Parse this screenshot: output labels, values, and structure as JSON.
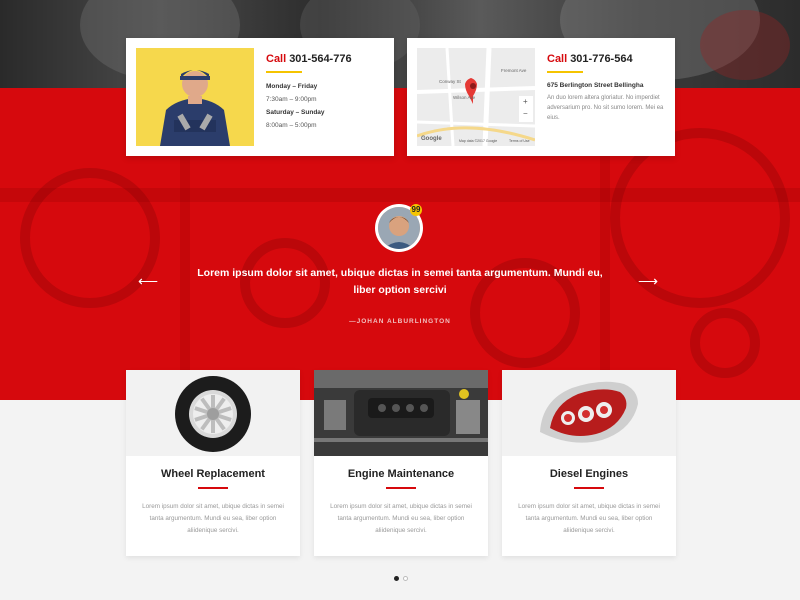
{
  "contacts": [
    {
      "call_word": "Call",
      "phone": "301-564-776",
      "hours": [
        {
          "day": "Monday – Friday",
          "time": "7:30am – 9:00pm"
        },
        {
          "day": "Saturday – Sunday",
          "time": "8:00am – 5:00pm"
        }
      ]
    },
    {
      "call_word": "Call",
      "phone": "301-776-564",
      "address": "675 Berlington Street Bellingha",
      "description": "An duo lorem altera gloriatur. No imperdiet adversarium pro. No sit sumo lorem. Mei ea eius."
    }
  ],
  "map": {
    "labels": [
      "Conway St",
      "Wilson Ave",
      "Fremont Ave",
      "Google",
      "Map data ©2017 Google",
      "Terms of Use"
    ],
    "zoom_in": "+",
    "zoom_out": "−"
  },
  "testimonial": {
    "badge": "99",
    "quote": "Lorem ipsum dolor sit amet, ubique dictas in semei tanta argumentum. Mundi eu, liber option sercivi",
    "author": "—JOHAN ALBURLINGTON",
    "prev_arrow": "⟵",
    "next_arrow": "⟶"
  },
  "services": [
    {
      "title": "Wheel Replacement",
      "description": "Lorem ipsum dolor sit amet, ubique dictas in semei tanta argumentum. Mundi eu sea, liber option aliidenique sercivi."
    },
    {
      "title": "Engine Maintenance",
      "description": "Lorem ipsum dolor sit amet, ubique dictas in semei tanta argumentum. Mundi eu sea, liber option aliidenique sercivi."
    },
    {
      "title": "Diesel Engines",
      "description": "Lorem ipsum dolor sit amet, ubique dictas in semei tanta argumentum. Mundi eu sea, liber option aliidenique sercivi."
    }
  ],
  "colors": {
    "accent": "#d6090d",
    "yellow": "#f5c400"
  },
  "pagination": {
    "pages": 2,
    "active": 1
  }
}
